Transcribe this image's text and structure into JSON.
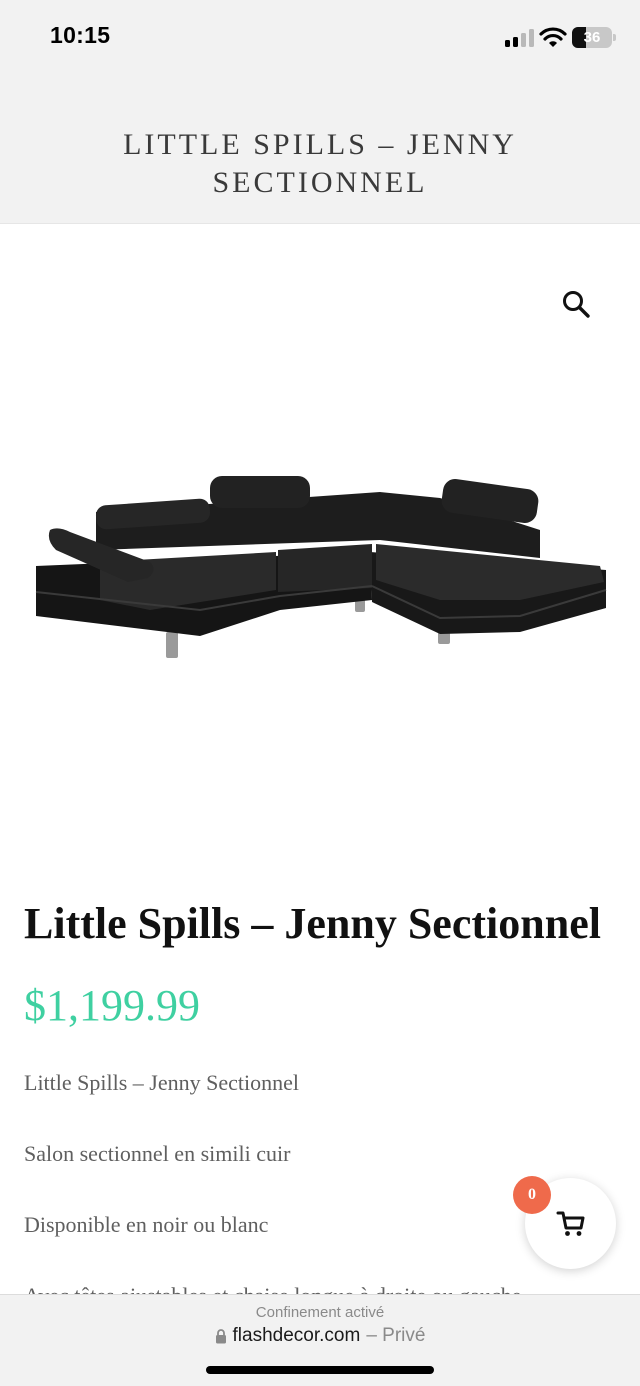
{
  "status_bar": {
    "time": "10:15",
    "battery": "36",
    "battery_level": 0.36,
    "icons": [
      "signal-icon",
      "wifi-icon",
      "battery-icon"
    ]
  },
  "header": {
    "site_title": "LITTLE SPILLS – JENNY SECTIONNEL"
  },
  "search": {
    "icon": "search-icon"
  },
  "product": {
    "title": "Little Spills – Jenny Sectionnel",
    "price": "$1,199.99",
    "description": [
      "Little Spills – Jenny Sectionnel",
      "Salon sectionnel en simili cuir",
      "Disponible en noir ou blanc",
      "Avec têtes ajustables et chaise longue à droite ou gauche"
    ]
  },
  "cart": {
    "count": "0",
    "icon": "cart-icon"
  },
  "browser": {
    "status": "Confinement activé",
    "domain": "flashdecor.com",
    "privacy": "– Privé",
    "icon": "lock-icon"
  },
  "colors": {
    "price": "#3fd0a1",
    "badge": "#ef6a4b",
    "header_bg": "#f2f2f2"
  }
}
